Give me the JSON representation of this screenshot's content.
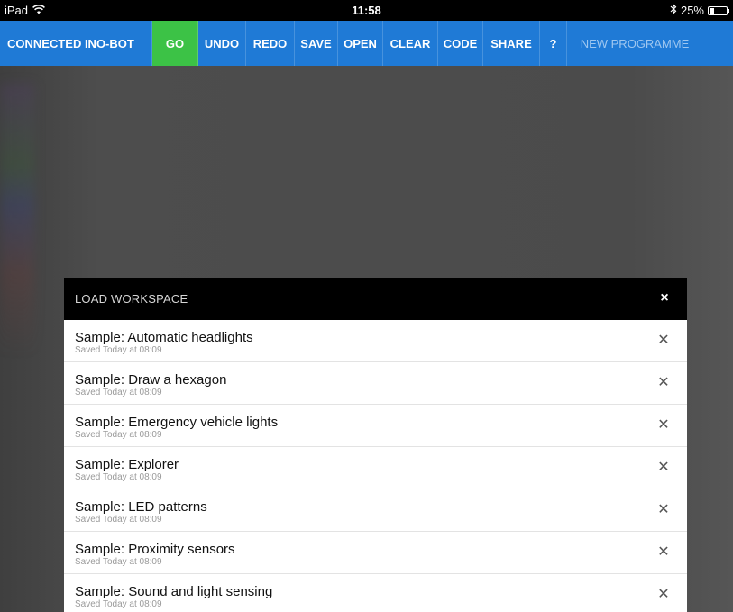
{
  "status_bar": {
    "device": "iPad",
    "wifi_icon": "wifi-icon",
    "time": "11:58",
    "bluetooth_icon": "bluetooth-icon",
    "battery_percent": "25%",
    "battery_level": 0.25
  },
  "toolbar": {
    "connected_label": "CONNECTED INO-BOT",
    "go_label": "GO",
    "undo_label": "UNDO",
    "redo_label": "REDO",
    "save_label": "SAVE",
    "open_label": "OPEN",
    "clear_label": "CLEAR",
    "code_label": "CODE",
    "share_label": "SHARE",
    "help_label": "?",
    "new_programme_label": "NEW PROGRAMME",
    "accent_color": "#1f7ad6",
    "go_color": "#3cc246"
  },
  "modal": {
    "title": "LOAD WORKSPACE",
    "close_glyph": "×",
    "delete_glyph": "✕",
    "items": [
      {
        "name": "Sample: Automatic headlights",
        "saved": "Saved Today at 08:09"
      },
      {
        "name": "Sample: Draw a hexagon",
        "saved": "Saved Today at 08:09"
      },
      {
        "name": "Sample: Emergency vehicle lights",
        "saved": "Saved Today at 08:09"
      },
      {
        "name": "Sample: Explorer",
        "saved": "Saved Today at 08:09"
      },
      {
        "name": "Sample: LED patterns",
        "saved": "Saved Today at 08:09"
      },
      {
        "name": "Sample: Proximity sensors",
        "saved": "Saved Today at 08:09"
      },
      {
        "name": "Sample: Sound and light sensing",
        "saved": "Saved Today at 08:09"
      }
    ]
  }
}
